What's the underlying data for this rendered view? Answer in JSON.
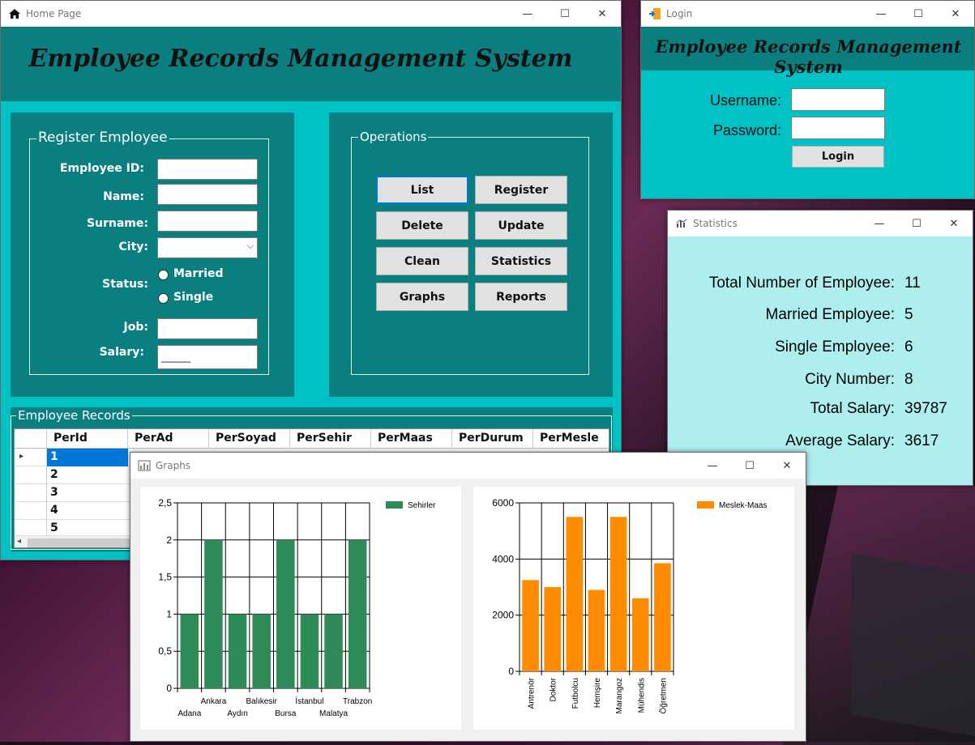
{
  "home": {
    "title": "Home Page",
    "header": "Employee Records Management System",
    "register_group": "Register Employee",
    "labels": {
      "employee_id": "Employee ID:",
      "name": "Name:",
      "surname": "Surname:",
      "city": "City:",
      "status": "Status:",
      "married": "Married",
      "single": "Single",
      "job": "Job:",
      "salary": "Salary:"
    },
    "salary_mask": "_____",
    "operations_group": "Operations",
    "buttons": {
      "list": "List",
      "register": "Register",
      "delete": "Delete",
      "update": "Update",
      "clean": "Clean",
      "statistics": "Statistics",
      "graphs": "Graphs",
      "reports": "Reports"
    },
    "records_group": "Employee Records",
    "columns": [
      "PerId",
      "PerAd",
      "PerSoyad",
      "PerSehir",
      "PerMaas",
      "PerDurum",
      "PerMesle"
    ],
    "rows": [
      "1",
      "2",
      "3",
      "4",
      "5"
    ]
  },
  "login": {
    "title": "Login",
    "header": "Employee Records Management System",
    "username_label": "Username:",
    "password_label": "Password:",
    "login_button": "Login"
  },
  "statistics": {
    "title": "Statistics",
    "items": [
      {
        "label": "Total Number of Employee:",
        "value": "11"
      },
      {
        "label": "Married Employee:",
        "value": "5"
      },
      {
        "label": "Single Employee:",
        "value": "6"
      },
      {
        "label": "City Number:",
        "value": "8"
      },
      {
        "label": "Total Salary:",
        "value": "39787"
      },
      {
        "label": "Average Salary:",
        "value": "3617"
      }
    ]
  },
  "graphs": {
    "title": "Graphs"
  },
  "window_controls": {
    "minimize": "—",
    "maximize": "☐",
    "close": "✕"
  },
  "colors": {
    "teal_dark": "#0b7f80",
    "teal_bright": "#00c1c3",
    "stats_bg": "#afeeee",
    "bar_green": "#2e8b57",
    "bar_orange": "#ff8c00"
  },
  "chart_data": [
    {
      "type": "bar",
      "categories": [
        "Adana",
        "Ankara",
        "Aydın",
        "Balıkesir",
        "Bursa",
        "İstanbul",
        "Malatya",
        "Trabzon"
      ],
      "series": [
        {
          "name": "Sehirler",
          "values": [
            1,
            2,
            1,
            1,
            2,
            1,
            1,
            2
          ]
        }
      ],
      "ylim": [
        0,
        2.5
      ],
      "yticks": [
        "0",
        "0,5",
        "1",
        "1,5",
        "2",
        "2,5"
      ],
      "ytick_values": [
        0,
        0.5,
        1,
        1.5,
        2,
        2.5
      ],
      "legend": "top-right",
      "grid": true
    },
    {
      "type": "bar",
      "categories": [
        "Antrenör",
        "Doktor",
        "Futbolcu",
        "Hemşire",
        "Marangoz",
        "Mühendis",
        "Öğretmen"
      ],
      "series": [
        {
          "name": "Meslek-Maas",
          "values": [
            3250,
            3000,
            5500,
            2900,
            5500,
            2600,
            3850
          ]
        }
      ],
      "ylim": [
        0,
        6000
      ],
      "yticks": [
        "0",
        "2000",
        "4000",
        "6000"
      ],
      "ytick_values": [
        0,
        2000,
        4000,
        6000
      ],
      "legend": "top-right",
      "grid": true
    }
  ]
}
